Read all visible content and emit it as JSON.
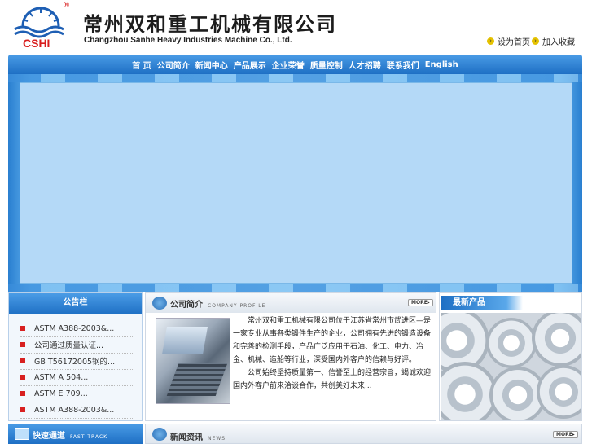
{
  "header": {
    "logo_text": "CSHI",
    "registered_mark": "®",
    "company_cn": "常州双和重工机械有限公司",
    "company_en": "Changzhou Sanhe  Heavy Industries Machine Co., Ltd.",
    "links": [
      {
        "label": "设为首页"
      },
      {
        "label": "加入收藏"
      }
    ]
  },
  "nav": {
    "items": [
      "首 页",
      "公司简介",
      "新闻中心",
      "产品展示",
      "企业荣誉",
      "质量控制",
      "人才招聘",
      "联系我们",
      "English"
    ]
  },
  "notice": {
    "title": "公告栏",
    "items": [
      "ASTM A388-2003&...",
      "公司通过质量认证...",
      "GB T56172005钢的...",
      "ASTM A 504...",
      "ASTM E 709...",
      "ASTM A388-2003&..."
    ]
  },
  "profile": {
    "title": "公司简介",
    "subtitle": "COMPANY PROFILE",
    "more": "MORE▸",
    "paragraph1": "常州双和重工机械有限公司位于江苏省常州市武进区—是一家专业从事各类锻件生产的企业，公司拥有先进的锻造设备和完善的检测手段，产品广泛应用于石油、化工、电力、冶金、机械、造船等行业，深受国内外客户的信赖与好评。",
    "paragraph2": "公司始终坚持质量第一、信誉至上的经营宗旨，竭诚欢迎国内外客户前来洽谈合作，共创美好未来..."
  },
  "products": {
    "title": "最新产品"
  },
  "fast_track": {
    "title": "快速通道",
    "subtitle": "FAST TRACK"
  },
  "news": {
    "title": "新闻资讯",
    "subtitle": "NEWS",
    "more": "MORE▸"
  },
  "colors": {
    "primary_blue": "#1e6fc4",
    "banner_blue": "#b4d9f7",
    "notice_bullet": "#d82020"
  }
}
